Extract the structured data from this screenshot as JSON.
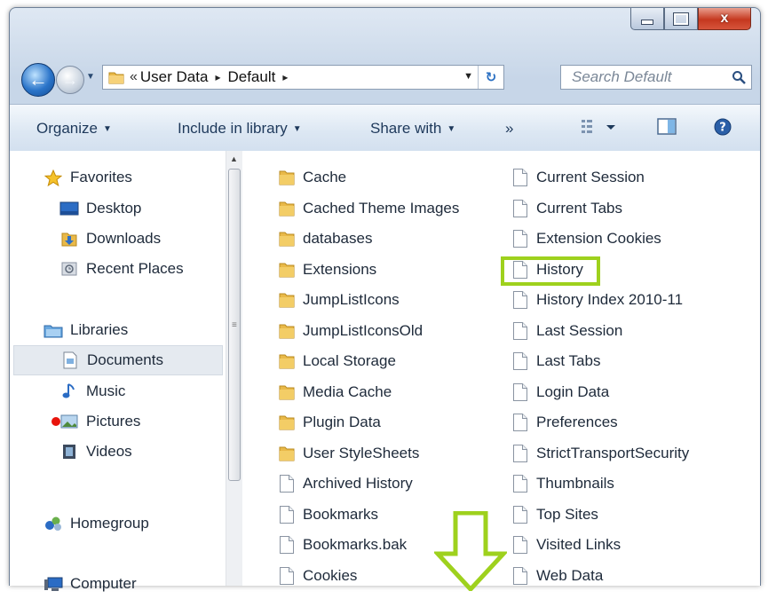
{
  "window": {
    "caption_buttons": [
      {
        "name": "minimize",
        "icon": "minimize-icon"
      },
      {
        "name": "maximize",
        "icon": "maximize-icon"
      },
      {
        "name": "close",
        "icon": "close-icon",
        "glyph": "x"
      }
    ]
  },
  "navigation": {
    "back_icon": "back-arrow-icon",
    "forward_icon": "forward-arrow-icon",
    "breadcrumb": {
      "overflow": "«",
      "items": [
        "User Data",
        "Default"
      ],
      "separator": "▸"
    },
    "refresh_glyph": "↻",
    "search": {
      "placeholder": "Search Default"
    }
  },
  "toolbar": {
    "organize": "Organize",
    "include_in_library": "Include in library",
    "share_with": "Share with",
    "more": "»",
    "caret": "▼"
  },
  "sidebar": {
    "favorites": {
      "label": "Favorites",
      "icon": "star-icon"
    },
    "favorites_items": [
      {
        "label": "Desktop",
        "icon": "desktop-icon"
      },
      {
        "label": "Downloads",
        "icon": "downloads-folder-icon"
      },
      {
        "label": "Recent Places",
        "icon": "recent-places-icon"
      }
    ],
    "libraries": {
      "label": "Libraries",
      "icon": "libraries-icon"
    },
    "library_items": [
      {
        "label": "Documents",
        "icon": "documents-icon",
        "selected": true
      },
      {
        "label": "Music",
        "icon": "music-icon"
      },
      {
        "label": "Pictures",
        "icon": "pictures-icon"
      },
      {
        "label": "Videos",
        "icon": "videos-icon"
      }
    ],
    "homegroup": {
      "label": "Homegroup",
      "icon": "homegroup-icon"
    },
    "computer": {
      "label": "Computer",
      "icon": "computer-icon"
    }
  },
  "files": {
    "column1": [
      {
        "name": "Cache",
        "type": "folder"
      },
      {
        "name": "Cached Theme Images",
        "type": "folder"
      },
      {
        "name": "databases",
        "type": "folder"
      },
      {
        "name": "Extensions",
        "type": "folder"
      },
      {
        "name": "JumpListIcons",
        "type": "folder"
      },
      {
        "name": "JumpListIconsOld",
        "type": "folder"
      },
      {
        "name": "Local Storage",
        "type": "folder"
      },
      {
        "name": "Media Cache",
        "type": "folder"
      },
      {
        "name": "Plugin Data",
        "type": "folder"
      },
      {
        "name": "User StyleSheets",
        "type": "folder"
      },
      {
        "name": "Archived History",
        "type": "file"
      },
      {
        "name": "Bookmarks",
        "type": "file"
      },
      {
        "name": "Bookmarks.bak",
        "type": "file"
      },
      {
        "name": "Cookies",
        "type": "file"
      }
    ],
    "column2": [
      {
        "name": "Current Session",
        "type": "file"
      },
      {
        "name": "Current Tabs",
        "type": "file"
      },
      {
        "name": "Extension Cookies",
        "type": "file"
      },
      {
        "name": "History",
        "type": "file",
        "highlighted": true
      },
      {
        "name": "History Index 2010-11",
        "type": "file"
      },
      {
        "name": "Last Session",
        "type": "file"
      },
      {
        "name": "Last Tabs",
        "type": "file"
      },
      {
        "name": "Login Data",
        "type": "file"
      },
      {
        "name": "Preferences",
        "type": "file"
      },
      {
        "name": "StrictTransportSecurity",
        "type": "file"
      },
      {
        "name": "Thumbnails",
        "type": "file"
      },
      {
        "name": "Top Sites",
        "type": "file"
      },
      {
        "name": "Visited Links",
        "type": "file"
      },
      {
        "name": "Web Data",
        "type": "file"
      }
    ]
  },
  "annotations": {
    "highlight_color": "#9ed11d",
    "arrow_icon": "down-arrow-annotation-icon"
  },
  "colors": {
    "folder": "#e9b949",
    "accent": "#2a74c9",
    "close": "#c5381f"
  }
}
